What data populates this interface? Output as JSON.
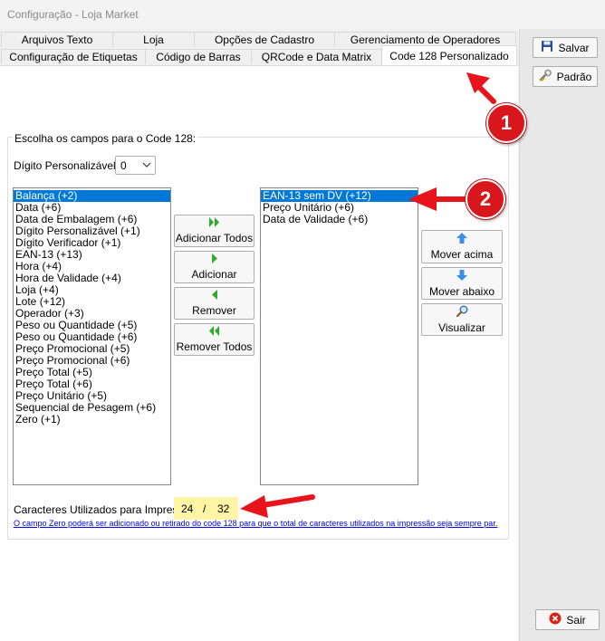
{
  "window": {
    "title": "Configuração - Loja Market"
  },
  "tabs": {
    "row1": [
      "Arquivos Texto",
      "Loja",
      "Opções de Cadastro",
      "Gerenciamento de Operadores"
    ],
    "row2": [
      "Configuração de Etiquetas",
      "Código de Barras",
      "QRCode e Data Matrix",
      "Code 128 Personalizado"
    ]
  },
  "sidebar": {
    "save_label": "Salvar",
    "default_label": "Padrão",
    "exit_label": "Sair"
  },
  "group": {
    "legend": "Escolha os campos para o Code 128:",
    "digit_label": "Dígito Personalizável",
    "digit_value": "0"
  },
  "available_fields": [
    "Balança (+2)",
    "Data (+6)",
    "Data de Embalagem (+6)",
    "Dígito Personalizável (+1)",
    "Dígito Verificador (+1)",
    "EAN-13 (+13)",
    "Hora (+4)",
    "Hora de Validade (+4)",
    "Loja (+4)",
    "Lote (+12)",
    "Operador (+3)",
    "Peso ou Quantidade (+5)",
    "Peso ou Quantidade (+6)",
    "Preço Promocional (+5)",
    "Preço Promocional (+6)",
    "Preço Total (+5)",
    "Preço Total (+6)",
    "Preço Unitário (+5)",
    "Sequencial de Pesagem (+6)",
    "Zero (+1)"
  ],
  "selected_fields": [
    "EAN-13 sem DV (+12)",
    "Preço Unitário (+6)",
    "Data de Validade (+6)"
  ],
  "transfer_buttons": {
    "add_all": "Adicionar Todos",
    "add": "Adicionar",
    "remove": "Remover",
    "remove_all": "Remover Todos"
  },
  "order_buttons": {
    "move_up": "Mover acima",
    "move_down": "Mover abaixo",
    "preview": "Visualizar"
  },
  "chars": {
    "label": "Caracteres Utilizados para Impressão:",
    "used": "24",
    "separator": "/",
    "total": "32"
  },
  "hint": "O campo Zero poderá ser adicionado ou retirado do code 128 para que o total de caracteres utilizados na impressão seja sempre par.",
  "annotations": {
    "badge1": "1",
    "badge2": "2"
  },
  "colors": {
    "selection": "#0078d7",
    "arrow_red": "#e8141b",
    "green_arrow": "#2eaa2e",
    "highlight": "#fdf4a6"
  }
}
